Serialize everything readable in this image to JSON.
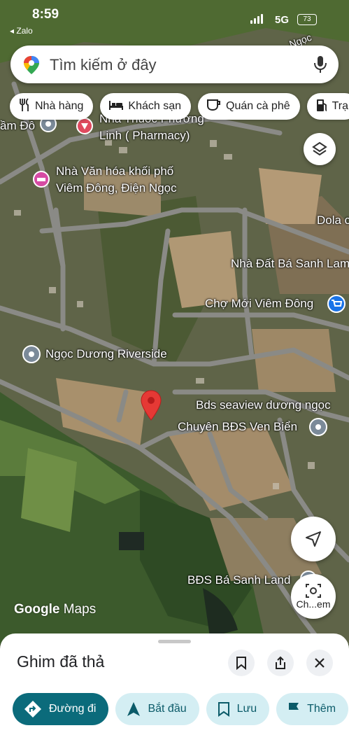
{
  "status_bar": {
    "time": "8:59",
    "back_app": "◂ Zalo",
    "network": "5G",
    "battery": "73"
  },
  "search": {
    "placeholder": "Tìm kiếm ở đây"
  },
  "categories": [
    {
      "label": "Nhà hàng",
      "icon": "fork-knife-icon"
    },
    {
      "label": "Khách sạn",
      "icon": "bed-icon"
    },
    {
      "label": "Quán cà phê",
      "icon": "coffee-cup-icon"
    },
    {
      "label": "Trạ",
      "icon": "gas-pump-icon"
    }
  ],
  "map_labels": {
    "lam_do": "ầm Đô",
    "pharmacy_line1": "Nhà Thuốc Phương",
    "pharmacy_line2": "Linh ( Pharmacy)",
    "cultural_line1": "Nhà Văn hóa khối phố",
    "cultural_line2": "Viêm Đông, Điện Ngọc",
    "dola": "Dola c",
    "land_office": "Nhà Đất Bá Sanh Lam",
    "market": "Chợ Mới Viêm Đông",
    "riverside": "Ngọc Dương Riverside",
    "seaview": "Bds seaview dương ngọc",
    "coastal": "Chuyên BĐS Ven Biển",
    "ba_sanh": "BĐS Bá Sanh Land",
    "road": "Ngọc"
  },
  "layers_button": {
    "icon": "layers-icon"
  },
  "locate_button": {
    "icon": "navigation-arrow-icon"
  },
  "lens_button": {
    "label": "Ch...em",
    "icon": "camera-lens-icon"
  },
  "watermark": {
    "google": "Google",
    "maps": "Maps"
  },
  "sheet": {
    "title": "Ghim đã thả",
    "actions": [
      {
        "label": "Đường đi",
        "icon": "directions-icon",
        "primary": true
      },
      {
        "label": "Bắt đầu",
        "icon": "navigation-icon"
      },
      {
        "label": "Lưu",
        "icon": "bookmark-icon"
      },
      {
        "label": "Thêm",
        "icon": "flag-icon"
      }
    ]
  },
  "colors": {
    "primary_action": "#0b6b7b",
    "secondary_action": "#d4eef3",
    "pin_red": "#e53935",
    "label_halo": "#000000"
  }
}
